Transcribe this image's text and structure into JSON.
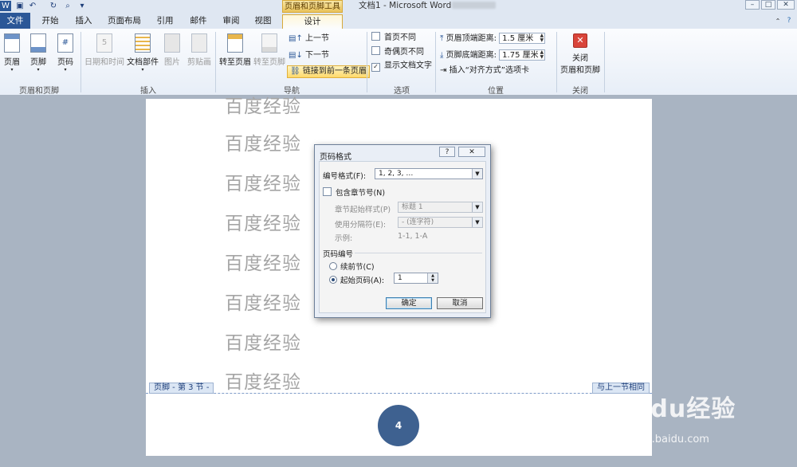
{
  "window": {
    "title": "文档1 - Microsoft Word",
    "context_tab_title": "页眉和页脚工具",
    "controls": [
      "–",
      "□",
      "✕"
    ]
  },
  "tabs": [
    "文件",
    "开始",
    "插入",
    "页面布局",
    "引用",
    "邮件",
    "审阅",
    "视图",
    "设计"
  ],
  "ribbon": {
    "groups": {
      "header_footer": {
        "label": "页眉和页脚",
        "buttons": [
          "页眉",
          "页脚",
          "页码"
        ]
      },
      "insert": {
        "label": "插入",
        "buttons": [
          "日期和时间",
          "文档部件",
          "图片",
          "剪贴画"
        ]
      },
      "navigation": {
        "label": "导航",
        "buttons": [
          "转至页眉",
          "转至页脚"
        ],
        "small": [
          "上一节",
          "下一节",
          "链接到前一条页眉"
        ]
      },
      "options": {
        "label": "选项",
        "items": [
          {
            "label": "首页不同",
            "checked": false
          },
          {
            "label": "奇偶页不同",
            "checked": false
          },
          {
            "label": "显示文档文字",
            "checked": true
          }
        ]
      },
      "position": {
        "label": "位置",
        "header_distance_label": "页眉顶端距离:",
        "header_distance": "1.5 厘米",
        "footer_distance_label": "页脚底端距离:",
        "footer_distance": "1.75 厘米",
        "insert_align_tab": "插入“对齐方式”选项卡"
      },
      "close": {
        "label": "关闭",
        "button": "关闭\n页眉和页脚",
        "button_line1": "关闭",
        "button_line2": "页眉和页脚"
      }
    }
  },
  "document": {
    "lines": [
      "百度经验",
      "百度经验",
      "百度经验",
      "百度经验",
      "百度经验",
      "百度经验",
      "百度经验",
      "百度经验"
    ],
    "footer_label": "页脚 - 第 3 节 -",
    "same_as_previous": "与上一节相同",
    "page_number": "4"
  },
  "dialog": {
    "title": "页码格式",
    "help": "?",
    "close": "✕",
    "number_format_label": "编号格式(F):",
    "number_format_value": "1, 2, 3, …",
    "include_chapter_label": "包含章节号(N)",
    "chapter_style_label": "章节起始样式(P)",
    "chapter_style_value": "标题 1",
    "separator_label": "使用分隔符(E):",
    "separator_value": "-  (连字符)",
    "example_label": "示例:",
    "example_value": "1-1, 1-A",
    "numbering_section": "页码编号",
    "continue_label": "续前节(C)",
    "start_at_label": "起始页码(A):",
    "start_at_value": "1",
    "ok": "确定",
    "cancel": "取消"
  },
  "watermark": {
    "brand": "Baidu经验",
    "url": "jingyan.baidu.com"
  }
}
